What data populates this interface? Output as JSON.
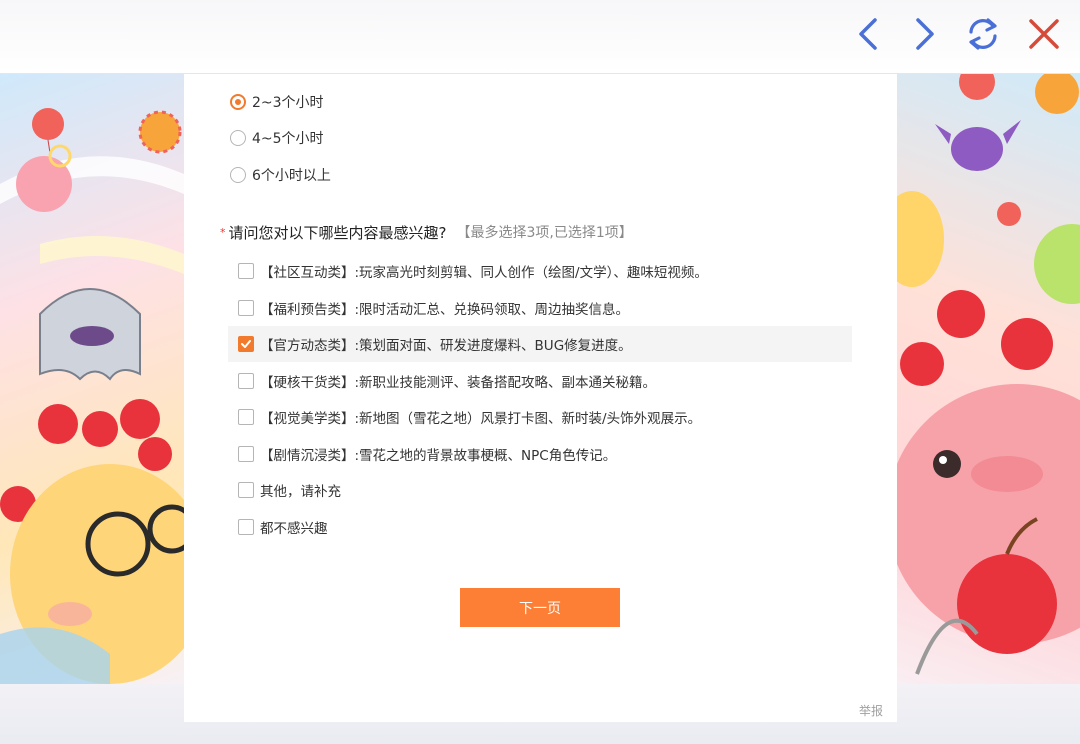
{
  "toolbar": {
    "back_icon": "chevron-left-icon",
    "forward_icon": "chevron-right-icon",
    "refresh_icon": "refresh-icon",
    "close_icon": "close-icon",
    "accent_color": "#4a6fd6",
    "close_color": "#d64a3a"
  },
  "survey": {
    "hours_options": [
      {
        "label": "2~3个小时",
        "selected": true
      },
      {
        "label": "4~5个小时",
        "selected": false
      },
      {
        "label": "6个小时以上",
        "selected": false
      }
    ],
    "question": {
      "required_mark": "*",
      "text": "请问您对以下哪些内容最感兴趣?",
      "hint": "【最多选择3项,已选择1项】"
    },
    "interest_options": [
      {
        "label": "【社区互动类】:玩家高光时刻剪辑、同人创作（绘图/文学）、趣味短视频。",
        "checked": false
      },
      {
        "label": "【福利预告类】:限时活动汇总、兑换码领取、周边抽奖信息。",
        "checked": false
      },
      {
        "label": "【官方动态类】:策划面对面、研发进度爆料、BUG修复进度。",
        "checked": true
      },
      {
        "label": "【硬核干货类】:新职业技能测评、装备搭配攻略、副本通关秘籍。",
        "checked": false
      },
      {
        "label": "【视觉美学类】:新地图（雪花之地）风景打卡图、新时装/头饰外观展示。",
        "checked": false
      },
      {
        "label": "【剧情沉浸类】:雪花之地的背景故事梗概、NPC角色传记。",
        "checked": false
      },
      {
        "label": "其他，请补充",
        "checked": false
      },
      {
        "label": "都不感兴趣",
        "checked": false
      }
    ],
    "next_label": "下一页",
    "accent_color": "#fd7e35"
  },
  "footer": {
    "report_label": "举报"
  }
}
